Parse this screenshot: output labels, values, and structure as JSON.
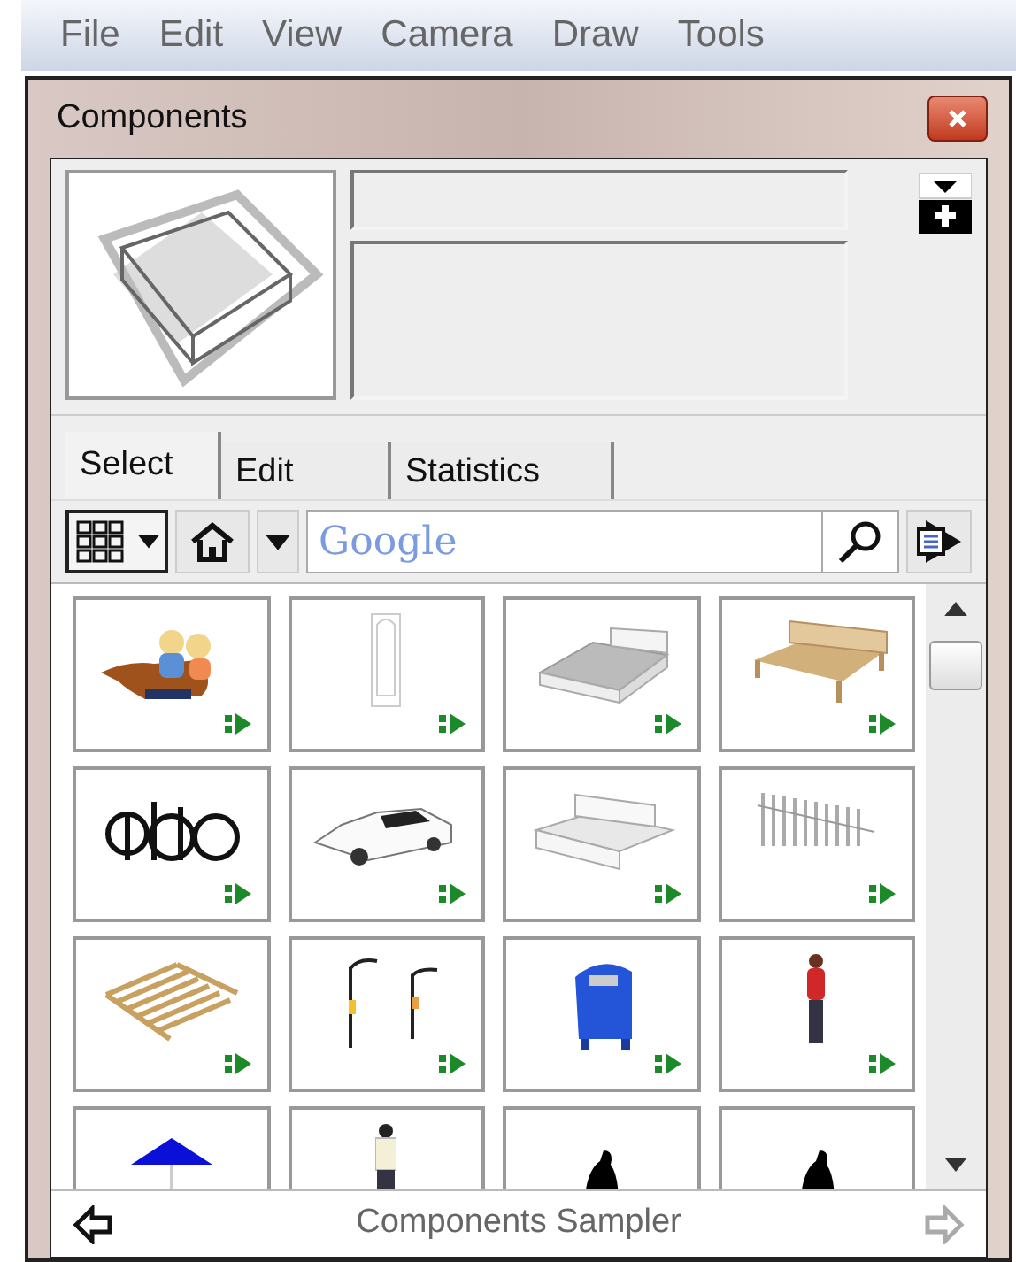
{
  "menu_bar": [
    "File",
    "Edit",
    "View",
    "Camera",
    "Draw",
    "Tools"
  ],
  "panel": {
    "title": "Components"
  },
  "tabs": [
    {
      "label": "Select",
      "selected": true
    },
    {
      "label": "Edit",
      "selected": false
    },
    {
      "label": "Statistics",
      "selected": false
    }
  ],
  "search": {
    "placeholder": "Google"
  },
  "tiles": [
    {
      "kind": "people",
      "load_arrow": true
    },
    {
      "kind": "door",
      "load_arrow": true
    },
    {
      "kind": "bed",
      "load_arrow": true
    },
    {
      "kind": "bench",
      "load_arrow": true
    },
    {
      "kind": "bicycles",
      "load_arrow": true
    },
    {
      "kind": "car",
      "load_arrow": true
    },
    {
      "kind": "sofa",
      "load_arrow": true
    },
    {
      "kind": "fence",
      "load_arrow": true
    },
    {
      "kind": "deck",
      "load_arrow": true
    },
    {
      "kind": "lamps",
      "load_arrow": true
    },
    {
      "kind": "mailbox",
      "load_arrow": true
    },
    {
      "kind": "woman",
      "load_arrow": true
    },
    {
      "kind": "umbrella"
    },
    {
      "kind": "man"
    },
    {
      "kind": "silhouette"
    },
    {
      "kind": "silhouette"
    }
  ],
  "footer": {
    "collection": "Components Sampler",
    "back_disabled": false,
    "forward_disabled": true
  }
}
